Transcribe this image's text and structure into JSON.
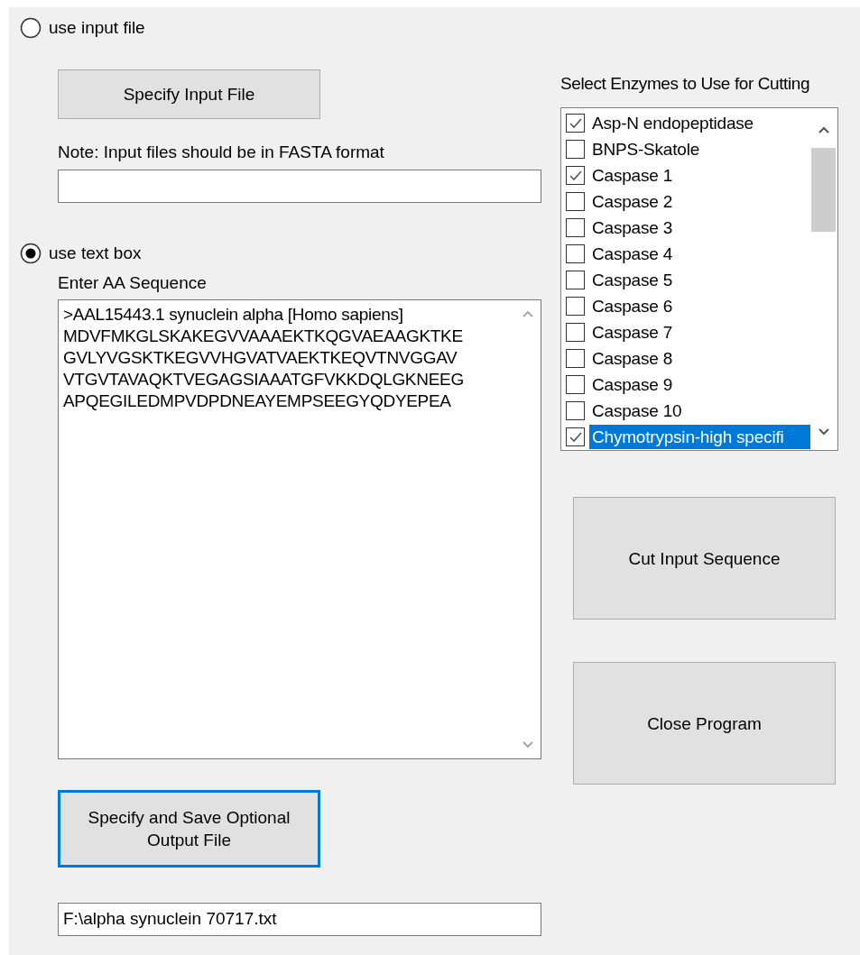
{
  "input_mode": [
    {
      "label": "use input file",
      "selected": false
    },
    {
      "label": "use text box",
      "selected": true
    }
  ],
  "input_file": {
    "button": {
      "label": "Specify Input File",
      "focused": false
    },
    "note": "Note: Input files should be in FASTA format"
  },
  "sequence": {
    "label": "Enter AA Sequence",
    "value": ">AAL15443.1 synuclein alpha [Homo sapiens]\nMDVFMKGLSKAKEGVVAAAEKTKQGVAEAAGKTKE\nGVLYVGSKTKEGVVHGVATVAEKTKEQVTNVGGAV\nVTGVTAVAQKTVEGAGSIAAATGFVKKDQLGKNEEG\nAPQEGILEDMPVDPDNEAYEMPSEEGYQDYEPEA"
  },
  "output": {
    "button": {
      "label": "Specify and Save Optional Output File",
      "focused": true
    },
    "path": "F:\\alpha synuclein 70717.txt"
  },
  "enzymes": {
    "label": "Select Enzymes to Use for Cutting",
    "items": [
      {
        "label": "Asp-N endopeptidase",
        "checked": true,
        "selected": false
      },
      {
        "label": "BNPS-Skatole",
        "checked": false,
        "selected": false
      },
      {
        "label": "Caspase 1",
        "checked": true,
        "selected": false
      },
      {
        "label": "Caspase 2",
        "checked": false,
        "selected": false
      },
      {
        "label": "Caspase 3",
        "checked": false,
        "selected": false
      },
      {
        "label": "Caspase 4",
        "checked": false,
        "selected": false
      },
      {
        "label": "Caspase 5",
        "checked": false,
        "selected": false
      },
      {
        "label": "Caspase 6",
        "checked": false,
        "selected": false
      },
      {
        "label": "Caspase 7",
        "checked": false,
        "selected": false
      },
      {
        "label": "Caspase 8",
        "checked": false,
        "selected": false
      },
      {
        "label": "Caspase 9",
        "checked": false,
        "selected": false
      },
      {
        "label": "Caspase 10",
        "checked": false,
        "selected": false
      },
      {
        "label": "Chymotrypsin-high specifi",
        "checked": true,
        "selected": true
      }
    ]
  },
  "actions": [
    {
      "label": "Cut Input Sequence",
      "focused": false
    },
    {
      "label": "Close Program",
      "focused": false
    }
  ]
}
